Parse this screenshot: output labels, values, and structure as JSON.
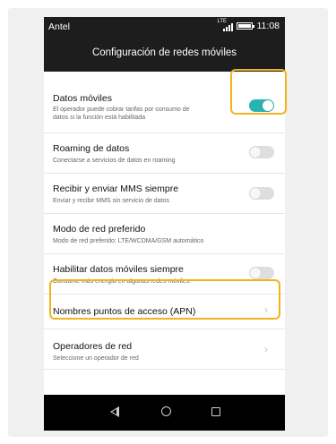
{
  "status_bar": {
    "carrier": "Antel",
    "network": "LTE",
    "time": "11:08"
  },
  "header": {
    "title": "Configuración de redes móviles"
  },
  "settings": {
    "mobile_data": {
      "title": "Datos móviles",
      "subtitle_line1": "El operador puede cobrar tarifas por consumo de",
      "subtitle_line2": "datos si la función está habilitada",
      "enabled": true
    },
    "roaming": {
      "title": "Roaming de datos",
      "subtitle": "Conectarse a servicios de datos en roaming",
      "enabled": false
    },
    "mms": {
      "title": "Recibir y enviar MMS siempre",
      "subtitle": "Enviar y recibir MMS sin servicio de datos",
      "enabled": false
    },
    "network_mode": {
      "title": "Modo de red preferido",
      "subtitle": "Modo de red preferido: LTE/WCDMA/GSM automático"
    },
    "always_data": {
      "title": "Habilitar datos móviles siempre",
      "subtitle": "Consume más energía en algunas redes móviles.",
      "enabled": false
    },
    "apn": {
      "title": "Nombres puntos de acceso (APN)"
    },
    "operators": {
      "title": "Operadores de red",
      "subtitle": "Seleccione un operador de red"
    }
  },
  "colors": {
    "toggle_on": "#29b3b1",
    "highlight": "#f2b31d",
    "header_bg": "#1d1d1d"
  },
  "icons": {
    "chevron": "chevron-right-icon",
    "nav": [
      "back-icon",
      "home-icon",
      "recent-apps-icon"
    ]
  }
}
